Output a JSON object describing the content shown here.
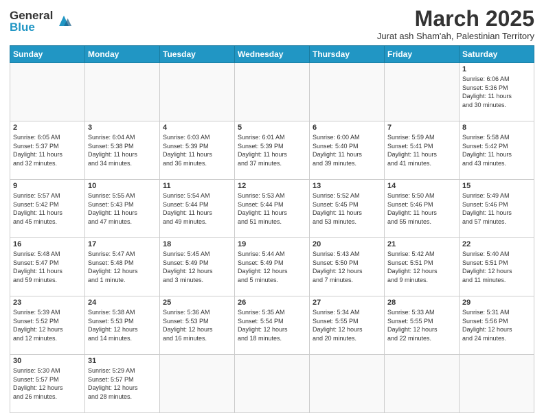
{
  "logo": {
    "text_general": "General",
    "text_blue": "Blue"
  },
  "header": {
    "month_title": "March 2025",
    "subtitle": "Jurat ash Sham'ah, Palestinian Territory"
  },
  "weekdays": [
    "Sunday",
    "Monday",
    "Tuesday",
    "Wednesday",
    "Thursday",
    "Friday",
    "Saturday"
  ],
  "weeks": [
    [
      {
        "day": "",
        "info": ""
      },
      {
        "day": "",
        "info": ""
      },
      {
        "day": "",
        "info": ""
      },
      {
        "day": "",
        "info": ""
      },
      {
        "day": "",
        "info": ""
      },
      {
        "day": "",
        "info": ""
      },
      {
        "day": "1",
        "info": "Sunrise: 6:06 AM\nSunset: 5:36 PM\nDaylight: 11 hours\nand 30 minutes."
      }
    ],
    [
      {
        "day": "2",
        "info": "Sunrise: 6:05 AM\nSunset: 5:37 PM\nDaylight: 11 hours\nand 32 minutes."
      },
      {
        "day": "3",
        "info": "Sunrise: 6:04 AM\nSunset: 5:38 PM\nDaylight: 11 hours\nand 34 minutes."
      },
      {
        "day": "4",
        "info": "Sunrise: 6:03 AM\nSunset: 5:39 PM\nDaylight: 11 hours\nand 36 minutes."
      },
      {
        "day": "5",
        "info": "Sunrise: 6:01 AM\nSunset: 5:39 PM\nDaylight: 11 hours\nand 37 minutes."
      },
      {
        "day": "6",
        "info": "Sunrise: 6:00 AM\nSunset: 5:40 PM\nDaylight: 11 hours\nand 39 minutes."
      },
      {
        "day": "7",
        "info": "Sunrise: 5:59 AM\nSunset: 5:41 PM\nDaylight: 11 hours\nand 41 minutes."
      },
      {
        "day": "8",
        "info": "Sunrise: 5:58 AM\nSunset: 5:42 PM\nDaylight: 11 hours\nand 43 minutes."
      }
    ],
    [
      {
        "day": "9",
        "info": "Sunrise: 5:57 AM\nSunset: 5:42 PM\nDaylight: 11 hours\nand 45 minutes."
      },
      {
        "day": "10",
        "info": "Sunrise: 5:55 AM\nSunset: 5:43 PM\nDaylight: 11 hours\nand 47 minutes."
      },
      {
        "day": "11",
        "info": "Sunrise: 5:54 AM\nSunset: 5:44 PM\nDaylight: 11 hours\nand 49 minutes."
      },
      {
        "day": "12",
        "info": "Sunrise: 5:53 AM\nSunset: 5:44 PM\nDaylight: 11 hours\nand 51 minutes."
      },
      {
        "day": "13",
        "info": "Sunrise: 5:52 AM\nSunset: 5:45 PM\nDaylight: 11 hours\nand 53 minutes."
      },
      {
        "day": "14",
        "info": "Sunrise: 5:50 AM\nSunset: 5:46 PM\nDaylight: 11 hours\nand 55 minutes."
      },
      {
        "day": "15",
        "info": "Sunrise: 5:49 AM\nSunset: 5:46 PM\nDaylight: 11 hours\nand 57 minutes."
      }
    ],
    [
      {
        "day": "16",
        "info": "Sunrise: 5:48 AM\nSunset: 5:47 PM\nDaylight: 11 hours\nand 59 minutes."
      },
      {
        "day": "17",
        "info": "Sunrise: 5:47 AM\nSunset: 5:48 PM\nDaylight: 12 hours\nand 1 minute."
      },
      {
        "day": "18",
        "info": "Sunrise: 5:45 AM\nSunset: 5:49 PM\nDaylight: 12 hours\nand 3 minutes."
      },
      {
        "day": "19",
        "info": "Sunrise: 5:44 AM\nSunset: 5:49 PM\nDaylight: 12 hours\nand 5 minutes."
      },
      {
        "day": "20",
        "info": "Sunrise: 5:43 AM\nSunset: 5:50 PM\nDaylight: 12 hours\nand 7 minutes."
      },
      {
        "day": "21",
        "info": "Sunrise: 5:42 AM\nSunset: 5:51 PM\nDaylight: 12 hours\nand 9 minutes."
      },
      {
        "day": "22",
        "info": "Sunrise: 5:40 AM\nSunset: 5:51 PM\nDaylight: 12 hours\nand 11 minutes."
      }
    ],
    [
      {
        "day": "23",
        "info": "Sunrise: 5:39 AM\nSunset: 5:52 PM\nDaylight: 12 hours\nand 12 minutes."
      },
      {
        "day": "24",
        "info": "Sunrise: 5:38 AM\nSunset: 5:53 PM\nDaylight: 12 hours\nand 14 minutes."
      },
      {
        "day": "25",
        "info": "Sunrise: 5:36 AM\nSunset: 5:53 PM\nDaylight: 12 hours\nand 16 minutes."
      },
      {
        "day": "26",
        "info": "Sunrise: 5:35 AM\nSunset: 5:54 PM\nDaylight: 12 hours\nand 18 minutes."
      },
      {
        "day": "27",
        "info": "Sunrise: 5:34 AM\nSunset: 5:55 PM\nDaylight: 12 hours\nand 20 minutes."
      },
      {
        "day": "28",
        "info": "Sunrise: 5:33 AM\nSunset: 5:55 PM\nDaylight: 12 hours\nand 22 minutes."
      },
      {
        "day": "29",
        "info": "Sunrise: 5:31 AM\nSunset: 5:56 PM\nDaylight: 12 hours\nand 24 minutes."
      }
    ],
    [
      {
        "day": "30",
        "info": "Sunrise: 5:30 AM\nSunset: 5:57 PM\nDaylight: 12 hours\nand 26 minutes."
      },
      {
        "day": "31",
        "info": "Sunrise: 5:29 AM\nSunset: 5:57 PM\nDaylight: 12 hours\nand 28 minutes."
      },
      {
        "day": "",
        "info": ""
      },
      {
        "day": "",
        "info": ""
      },
      {
        "day": "",
        "info": ""
      },
      {
        "day": "",
        "info": ""
      },
      {
        "day": "",
        "info": ""
      }
    ]
  ]
}
